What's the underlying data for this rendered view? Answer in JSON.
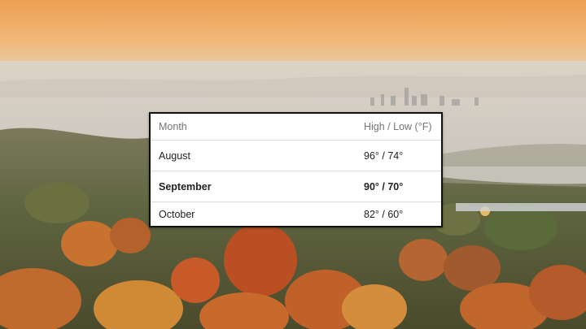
{
  "weather_table": {
    "headers": {
      "month": "Month",
      "temps": "High / Low (°F)"
    },
    "rows": [
      {
        "month": "August",
        "temps": "96° / 74°",
        "highlighted": false
      },
      {
        "month": "September",
        "temps": "90° / 70°",
        "highlighted": true
      },
      {
        "month": "October",
        "temps": "82° / 60°",
        "highlighted": false
      }
    ]
  },
  "colors": {
    "sky_top": "#f0a457",
    "sky_bottom": "#e9c9a8",
    "fog": "#d7d2cb",
    "foliage_orange": "#c8662e",
    "foliage_green": "#5b6b3c",
    "card_border": "#111111",
    "header_text": "#757575"
  }
}
